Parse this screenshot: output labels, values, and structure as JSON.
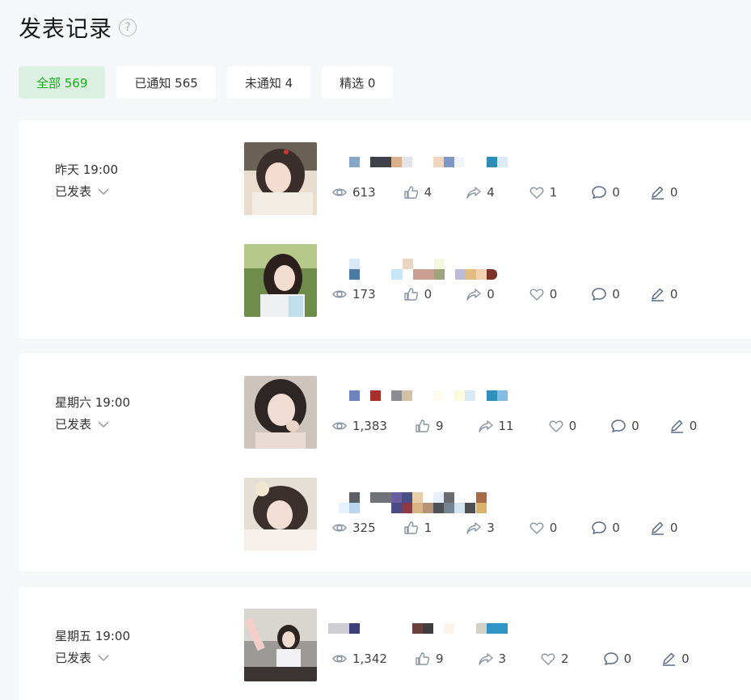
{
  "header": {
    "title": "发表记录",
    "help_glyph": "?"
  },
  "tabs": [
    {
      "label": "全部 569",
      "active": true
    },
    {
      "label": "已通知 565",
      "active": false
    },
    {
      "label": "未通知 4",
      "active": false
    },
    {
      "label": "精选 0",
      "active": false
    }
  ],
  "groups": [
    {
      "date": "昨天 19:00",
      "status": "已发表",
      "posts": [
        {
          "views": "613",
          "likes": "4",
          "shares": "4",
          "favs": "1",
          "comments": "0",
          "edits": "0"
        },
        {
          "views": "173",
          "likes": "0",
          "shares": "0",
          "favs": "0",
          "comments": "0",
          "edits": "0"
        }
      ]
    },
    {
      "date": "星期六 19:00",
      "status": "已发表",
      "posts": [
        {
          "views": "1,383",
          "likes": "9",
          "shares": "11",
          "favs": "0",
          "comments": "0",
          "edits": "0"
        },
        {
          "views": "325",
          "likes": "1",
          "shares": "3",
          "favs": "0",
          "comments": "0",
          "edits": "0"
        }
      ]
    },
    {
      "date": "星期五 19:00",
      "status": "已发表",
      "posts": [
        {
          "views": "1,342",
          "likes": "9",
          "shares": "3",
          "favs": "2",
          "comments": "0",
          "edits": "0"
        }
      ]
    }
  ],
  "colors": {
    "accent": "#1aad19",
    "active_tab_bg": "#dcf1e4",
    "page_bg": "#f6f7f8",
    "icon": "#8a94a6"
  }
}
